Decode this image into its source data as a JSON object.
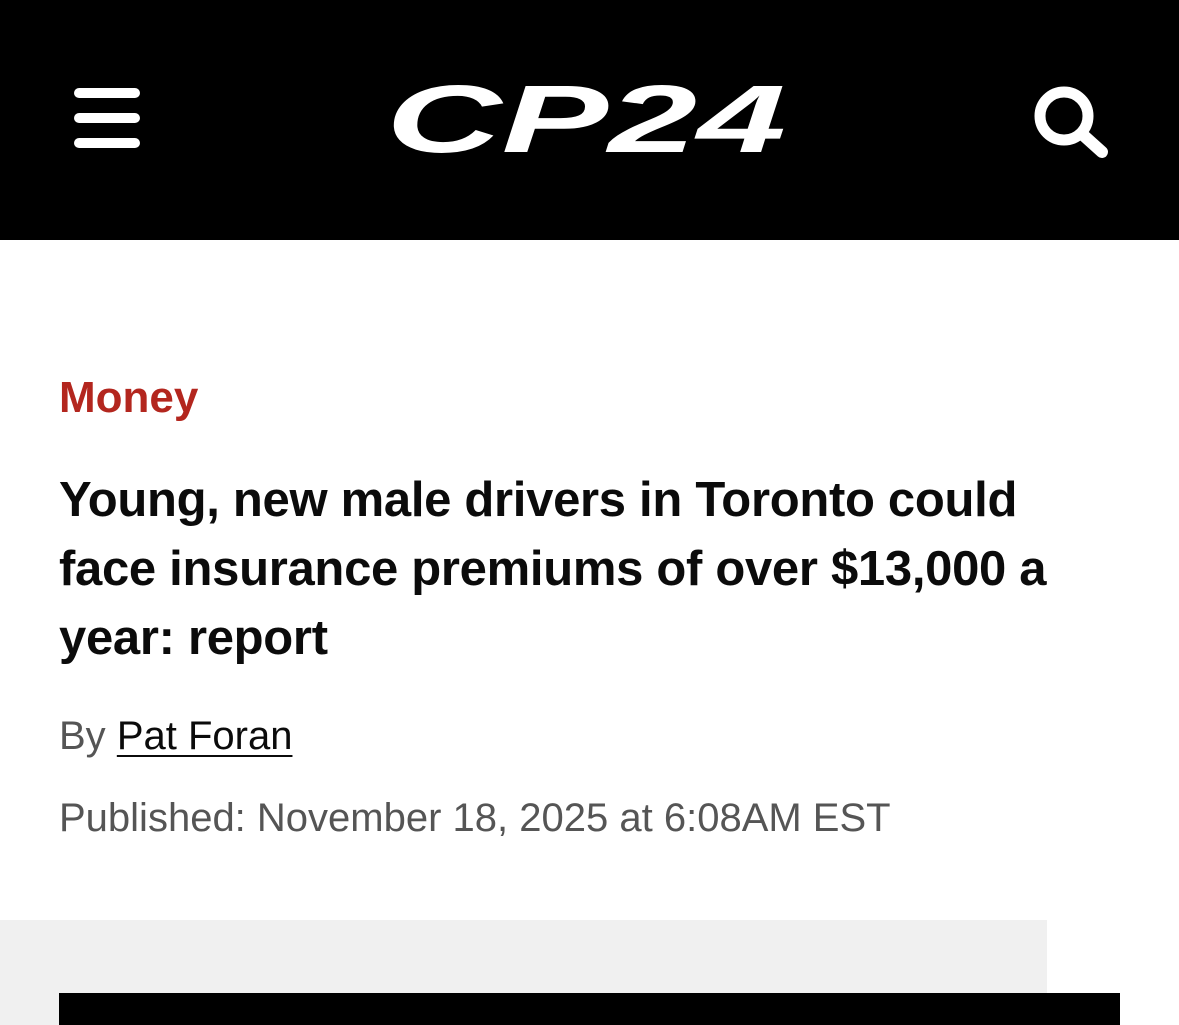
{
  "header": {
    "logo_text": "CP24",
    "menu_icon": "hamburger-menu-icon",
    "search_icon": "search-icon"
  },
  "article": {
    "category": "Money",
    "headline": "Young, new male drivers in Toronto could face insurance premiums of over $13,000 a year: report",
    "byline_prefix": "By",
    "author": "Pat Foran",
    "published_label": "Published:",
    "published_value": "November 18, 2025 at 6:08AM EST"
  },
  "colors": {
    "header_bg": "#000000",
    "category": "#b3261e",
    "meta_text": "#555555",
    "media_bg": "#f0f0f0"
  }
}
